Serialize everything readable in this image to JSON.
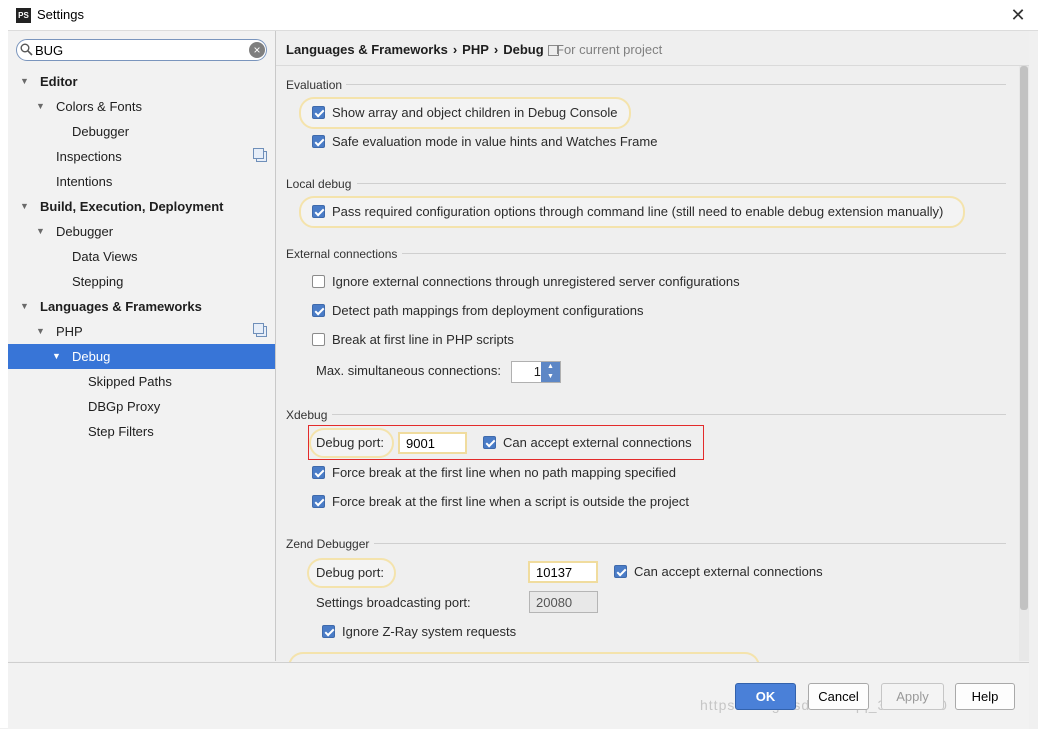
{
  "window": {
    "title": "Settings",
    "app_icon_text": "PS",
    "close_glyph": "✕"
  },
  "search": {
    "value": "BUG"
  },
  "tree": [
    {
      "label": "Editor",
      "level": 0,
      "bold": true,
      "arrow": true
    },
    {
      "label": "Colors & Fonts",
      "level": 1,
      "bold": false,
      "arrow": true
    },
    {
      "label": "Debugger",
      "level": 2,
      "bold": false,
      "arrow": false
    },
    {
      "label": "Inspections",
      "level": 1,
      "bold": false,
      "arrow": false,
      "project_icon": true
    },
    {
      "label": "Intentions",
      "level": 1,
      "bold": false,
      "arrow": false
    },
    {
      "label": "Build, Execution, Deployment",
      "level": 0,
      "bold": true,
      "arrow": true
    },
    {
      "label": "Debugger",
      "level": 1,
      "bold": false,
      "arrow": true
    },
    {
      "label": "Data Views",
      "level": 2,
      "bold": false,
      "arrow": false
    },
    {
      "label": "Stepping",
      "level": 2,
      "bold": false,
      "arrow": false
    },
    {
      "label": "Languages & Frameworks",
      "level": 0,
      "bold": true,
      "arrow": true
    },
    {
      "label": "PHP",
      "level": 1,
      "bold": false,
      "arrow": true,
      "project_icon": true
    },
    {
      "label": "Debug",
      "level": 2,
      "bold": false,
      "arrow": true,
      "selected": true
    },
    {
      "label": "Skipped Paths",
      "level": 3,
      "bold": false,
      "arrow": false
    },
    {
      "label": "DBGp Proxy",
      "level": 3,
      "bold": false,
      "arrow": false
    },
    {
      "label": "Step Filters",
      "level": 3,
      "bold": false,
      "arrow": false
    }
  ],
  "breadcrumb": {
    "part1": "Languages & Frameworks",
    "part2": "PHP",
    "part3": "Debug",
    "separator": "›",
    "project_note": "For current project"
  },
  "sections": {
    "evaluation": {
      "title": "Evaluation",
      "show_children": {
        "label": "Show array and object children in Debug Console",
        "checked": true
      },
      "safe_eval": {
        "label": "Safe evaluation mode in value hints and Watches Frame",
        "checked": true
      }
    },
    "local_debug": {
      "title": "Local debug",
      "pass_options": {
        "label": "Pass required configuration options through command line (still need to enable debug extension manually)",
        "checked": true
      }
    },
    "external": {
      "title": "External connections",
      "ignore_unregistered": {
        "label": "Ignore external connections through unregistered server configurations",
        "checked": false
      },
      "detect_mappings": {
        "label": "Detect path mappings from deployment configurations",
        "checked": true
      },
      "break_first_line": {
        "label": "Break at first line in PHP scripts",
        "checked": false
      },
      "max_connections_label": "Max. simultaneous connections:",
      "max_connections_value": "1"
    },
    "xdebug": {
      "title": "Xdebug",
      "port_label": "Debug port:",
      "port_value": "9001",
      "accept_external": {
        "label": "Can accept external connections",
        "checked": true
      },
      "force_break_no_mapping": {
        "label": "Force break at the first line when no path mapping specified",
        "checked": true
      },
      "force_break_outside": {
        "label": "Force break at the first line when a script is outside the project",
        "checked": true
      }
    },
    "zend": {
      "title": "Zend Debugger",
      "port_label": "Debug port:",
      "port_value": "10137",
      "accept_external": {
        "label": "Can accept external connections",
        "checked": true
      },
      "broadcast_label": "Settings broadcasting port:",
      "broadcast_value": "20080",
      "ignore_zray": {
        "label": "Ignore Z-Ray system requests",
        "checked": true
      }
    }
  },
  "buttons": {
    "ok": "OK",
    "cancel": "Cancel",
    "apply": "Apply",
    "help": "Help"
  },
  "watermark": "https://blog.csdn.net/qq_36666260",
  "colors": {
    "selection": "#3875d7",
    "accent_button": "#4a80d8",
    "highlight_outline": "#f4e3ac",
    "red_box": "#e32b2b"
  }
}
